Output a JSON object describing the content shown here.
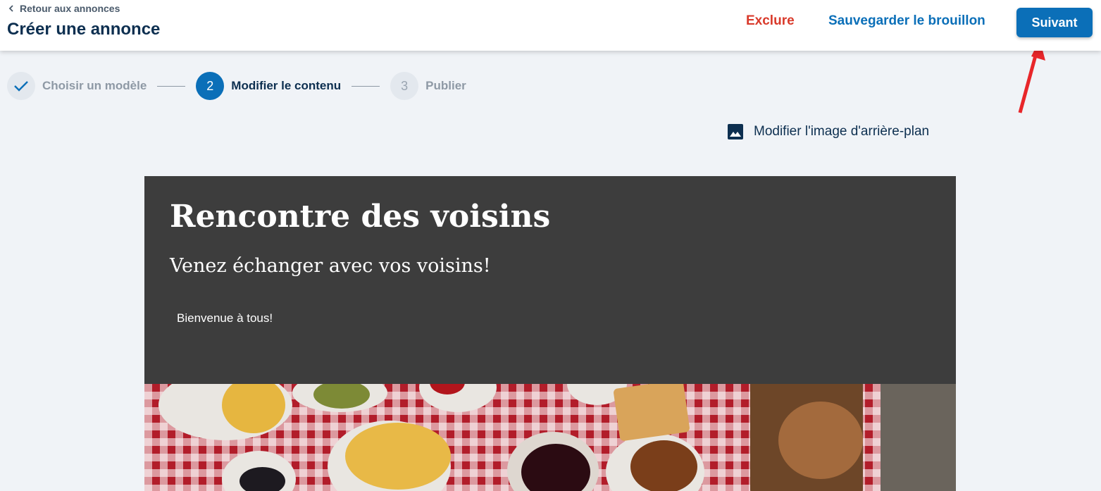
{
  "header": {
    "back_label": "Retour aux annonces",
    "title": "Créer une annonce",
    "exclude_label": "Exclure",
    "save_draft_label": "Sauvegarder le brouillon",
    "next_label": "Suivant"
  },
  "stepper": {
    "steps": [
      {
        "number": "✓",
        "label": "Choisir un modèle",
        "state": "done"
      },
      {
        "number": "2",
        "label": "Modifier le contenu",
        "state": "active"
      },
      {
        "number": "3",
        "label": "Publier",
        "state": "todo"
      }
    ]
  },
  "editor": {
    "modify_background_label": "Modifier l'image d'arrière-plan",
    "preview_title": "Rencontre des voisins",
    "preview_subtitle": "Venez échanger avec vos voisins!",
    "preview_body": "Bienvenue à tous!"
  },
  "colors": {
    "primary": "#0b6fb8",
    "danger": "#d93a2b",
    "title": "#0d2f50",
    "preview_bg": "#3d3d3d",
    "annotation_arrow": "#e8262a"
  },
  "icons": {
    "back": "chevron-left-icon",
    "check": "check-icon",
    "image": "image-icon"
  }
}
